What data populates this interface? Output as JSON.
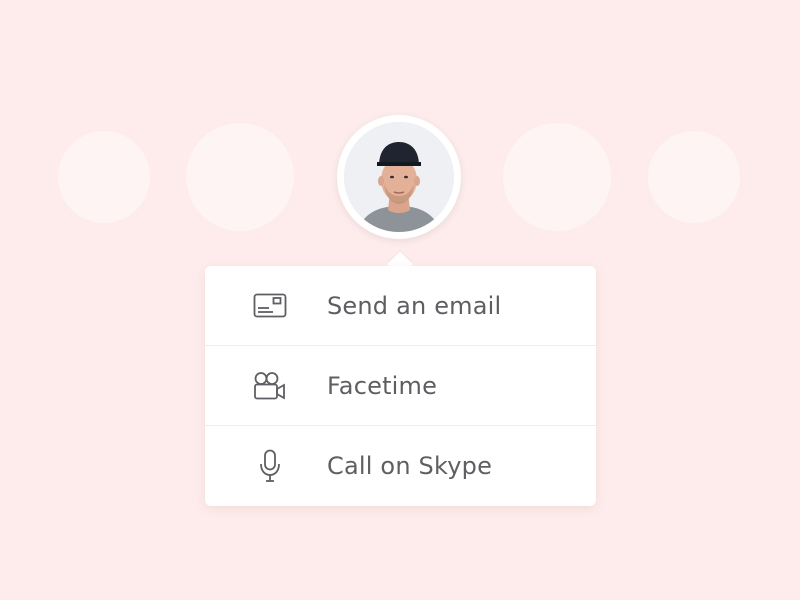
{
  "contacts": [
    {
      "name": "contact-placeholder-1",
      "selected": false
    },
    {
      "name": "contact-placeholder-2",
      "selected": false
    },
    {
      "name": "selected-contact",
      "selected": true,
      "avatar_icon": "person-photo"
    },
    {
      "name": "contact-placeholder-4",
      "selected": false
    },
    {
      "name": "contact-placeholder-5",
      "selected": false
    }
  ],
  "menu": {
    "items": [
      {
        "label": "Send an email",
        "icon": "email-card-icon"
      },
      {
        "label": "Facetime",
        "icon": "video-camera-icon"
      },
      {
        "label": "Call on Skype",
        "icon": "microphone-icon"
      }
    ]
  },
  "colors": {
    "background": "#fdeceb",
    "menu_background": "#ffffff",
    "text": "#5f5f63",
    "icon": "#5f5f63"
  }
}
